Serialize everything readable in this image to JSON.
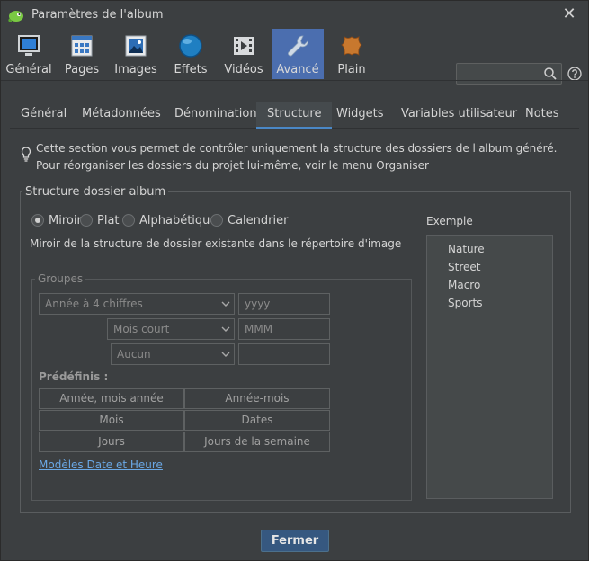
{
  "window": {
    "title": "Paramètres de l'album",
    "close_glyph": "✕"
  },
  "toolbar": {
    "items": [
      {
        "label": "Général",
        "icon": "monitor-icon"
      },
      {
        "label": "Pages",
        "icon": "grid-page-icon"
      },
      {
        "label": "Images",
        "icon": "image-icon"
      },
      {
        "label": "Effets",
        "icon": "sphere-icon"
      },
      {
        "label": "Vidéos",
        "icon": "film-icon"
      },
      {
        "label": "Avancé",
        "icon": "wrench-icon",
        "active": true
      },
      {
        "label": "Plain",
        "icon": "leather-icon"
      }
    ],
    "search_placeholder": ""
  },
  "tabs": [
    {
      "label": "Général"
    },
    {
      "label": "Métadonnées"
    },
    {
      "label": "Dénomination"
    },
    {
      "label": "Structure",
      "active": true
    },
    {
      "label": "Widgets"
    },
    {
      "label": "Variables utilisateur"
    },
    {
      "label": "Notes"
    }
  ],
  "info": {
    "line1": "Cette section vous permet de contrôler uniquement la structure des dossiers de l'album généré.",
    "line2": "Pour réorganiser les dossiers du projet lui-même, voir le menu Organiser"
  },
  "structure": {
    "title": "Structure dossier album",
    "options": [
      {
        "label": "Miroir",
        "checked": true
      },
      {
        "label": "Plat",
        "checked": false
      },
      {
        "label": "Alphabétique",
        "checked": false
      },
      {
        "label": "Calendrier",
        "checked": false
      }
    ],
    "description": "Miroir de la structure de dossier existante dans le répertoire d'image"
  },
  "groupes": {
    "title": "Groupes",
    "rows": [
      {
        "select": "Année à 4 chiffres",
        "field": "yyyy"
      },
      {
        "select": "Mois court",
        "field": "MMM"
      },
      {
        "select": "Aucun",
        "field": ""
      }
    ],
    "predefined_label": "Prédéfinis :",
    "presets": [
      "Année, mois année",
      "Année-mois",
      "Mois",
      "Dates",
      "Jours",
      "Jours de la semaine"
    ],
    "link": "Modèles Date et Heure"
  },
  "example": {
    "label": "Exemple",
    "items": [
      "Nature",
      "Street",
      "Macro",
      "Sports"
    ]
  },
  "footer": {
    "close_label": "Fermer"
  },
  "colors": {
    "accent": "#4b6eaf",
    "background": "#3c3f41",
    "link": "#6aa8e6",
    "button": "#365880"
  }
}
